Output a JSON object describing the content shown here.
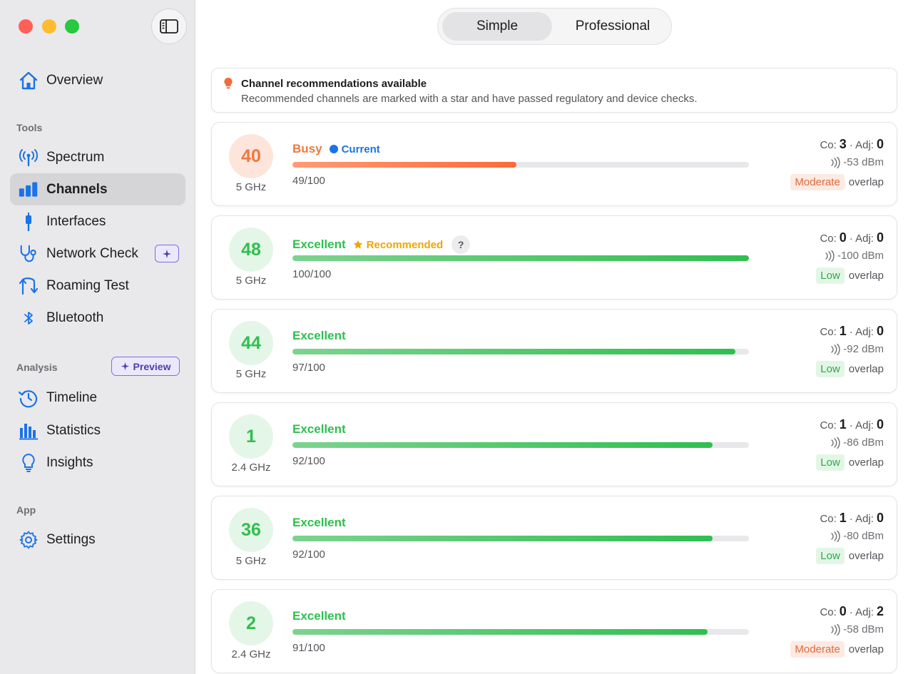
{
  "colors": {
    "accent": "#1a73e8",
    "excellent": "#2fbf4f",
    "busy": "#f0773f",
    "recommended": "#f0a500"
  },
  "sidebar": {
    "toggle_icon": "sidebar-toggle-icon",
    "items_top": [
      {
        "label": "Overview",
        "icon": "house-icon"
      }
    ],
    "tools_label": "Tools",
    "tools": [
      {
        "label": "Spectrum",
        "icon": "antenna-icon"
      },
      {
        "label": "Channels",
        "icon": "bars-icon",
        "active": true
      },
      {
        "label": "Interfaces",
        "icon": "plug-icon"
      },
      {
        "label": "Network Check",
        "icon": "stethoscope-icon"
      },
      {
        "label": "Roaming Test",
        "icon": "roaming-arrows-icon"
      },
      {
        "label": "Bluetooth",
        "icon": "bluetooth-icon"
      }
    ],
    "analysis_label": "Analysis",
    "preview_label": "Preview",
    "analysis": [
      {
        "label": "Timeline",
        "icon": "history-icon"
      },
      {
        "label": "Statistics",
        "icon": "chart-icon"
      },
      {
        "label": "Insights",
        "icon": "lightbulb-icon"
      }
    ],
    "app_label": "App",
    "app": [
      {
        "label": "Settings",
        "icon": "gear-icon"
      }
    ]
  },
  "mode": {
    "simple": "Simple",
    "professional": "Professional",
    "selected": "Simple"
  },
  "banner": {
    "title": "Channel recommendations available",
    "text": "Recommended channels are marked with a star and have passed regulatory and device checks."
  },
  "labels": {
    "co": "Co:",
    "adj": "· Adj:",
    "overlap": "overlap",
    "current": "Current",
    "recommended": "Recommended",
    "help": "?"
  },
  "channels": [
    {
      "channel": "40",
      "band": "5 GHz",
      "status": "Busy",
      "tag": "current",
      "score": 49,
      "score_text": "49/100",
      "co": "3",
      "adj": "0",
      "dbm": "-53 dBm",
      "overlap": "Moderate",
      "tone": "orange"
    },
    {
      "channel": "48",
      "band": "5 GHz",
      "status": "Excellent",
      "tag": "recommended",
      "score": 100,
      "score_text": "100/100",
      "co": "0",
      "adj": "0",
      "dbm": "-100 dBm",
      "overlap": "Low",
      "tone": "green"
    },
    {
      "channel": "44",
      "band": "5 GHz",
      "status": "Excellent",
      "tag": "",
      "score": 97,
      "score_text": "97/100",
      "co": "1",
      "adj": "0",
      "dbm": "-92 dBm",
      "overlap": "Low",
      "tone": "green"
    },
    {
      "channel": "1",
      "band": "2.4 GHz",
      "status": "Excellent",
      "tag": "",
      "score": 92,
      "score_text": "92/100",
      "co": "1",
      "adj": "0",
      "dbm": "-86 dBm",
      "overlap": "Low",
      "tone": "green"
    },
    {
      "channel": "36",
      "band": "5 GHz",
      "status": "Excellent",
      "tag": "",
      "score": 92,
      "score_text": "92/100",
      "co": "1",
      "adj": "0",
      "dbm": "-80 dBm",
      "overlap": "Low",
      "tone": "green"
    },
    {
      "channel": "2",
      "band": "2.4 GHz",
      "status": "Excellent",
      "tag": "",
      "score": 91,
      "score_text": "91/100",
      "co": "0",
      "adj": "2",
      "dbm": "-58 dBm",
      "overlap": "Moderate",
      "tone": "green"
    }
  ]
}
